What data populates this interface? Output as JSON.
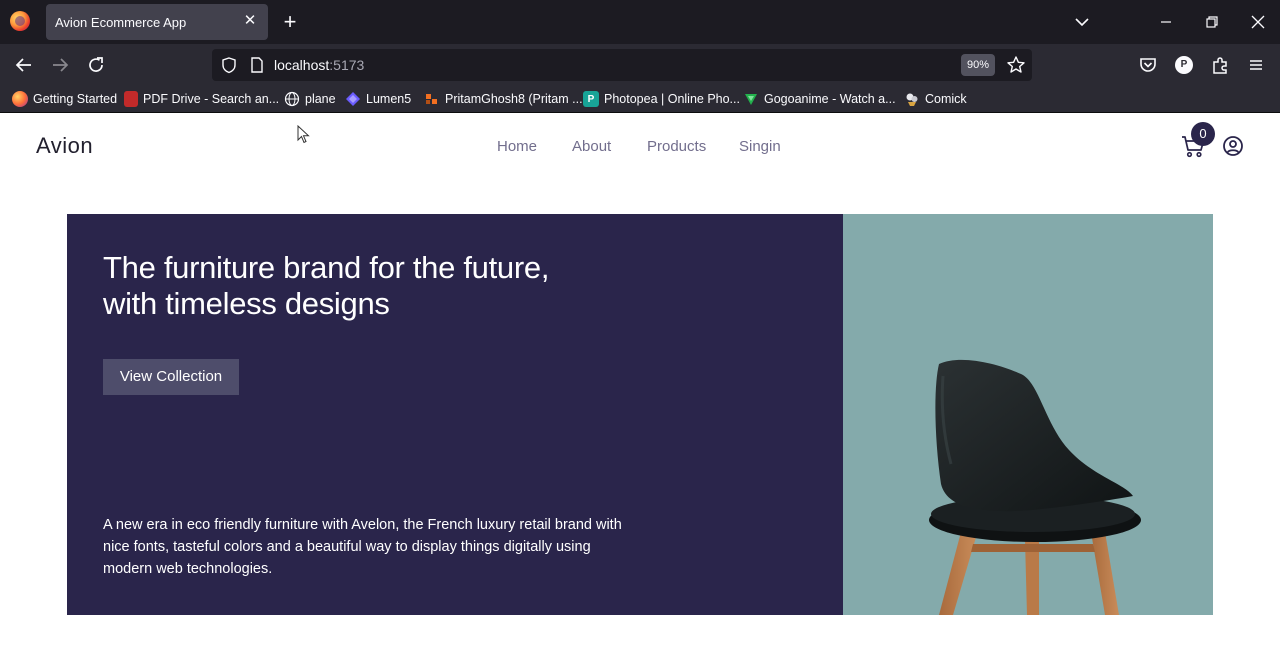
{
  "browser": {
    "tab_title": "Avion Ecommerce App",
    "url_host": "localhost",
    "url_port": ":5173",
    "zoom": "90%",
    "profile_initial": "P",
    "bookmarks": [
      {
        "label": "Getting Started",
        "icon": "firefox-icon"
      },
      {
        "label": "PDF Drive - Search an...",
        "icon": "pdf-drive-icon"
      },
      {
        "label": "plane",
        "icon": "globe-icon"
      },
      {
        "label": "Lumen5",
        "icon": "lumen5-icon"
      },
      {
        "label": "PritamGhosh8 (Pritam ...",
        "icon": "codepen-icon"
      },
      {
        "label": "Photopea | Online Pho...",
        "icon": "photopea-icon"
      },
      {
        "label": "Gogoanime - Watch a...",
        "icon": "gogoanime-icon"
      },
      {
        "label": "Comick",
        "icon": "comick-icon"
      }
    ]
  },
  "site": {
    "logo": "Avion",
    "nav": [
      {
        "label": "Home"
      },
      {
        "label": "About"
      },
      {
        "label": "Products"
      },
      {
        "label": "Singin"
      }
    ],
    "cart_count": "0"
  },
  "hero": {
    "title": "The furniture brand for the future, with timeless designs",
    "cta": "View Collection",
    "description": "A new era in eco friendly furniture with Avelon, the French luxury retail brand with nice fonts, tasteful colors and a beautiful way to display things digitally using modern web technologies."
  },
  "colors": {
    "hero_bg": "#2a254b",
    "hero_image_bg": "#84aaab",
    "button_bg": "#4e4d6b",
    "nav_text": "#726e8d"
  }
}
